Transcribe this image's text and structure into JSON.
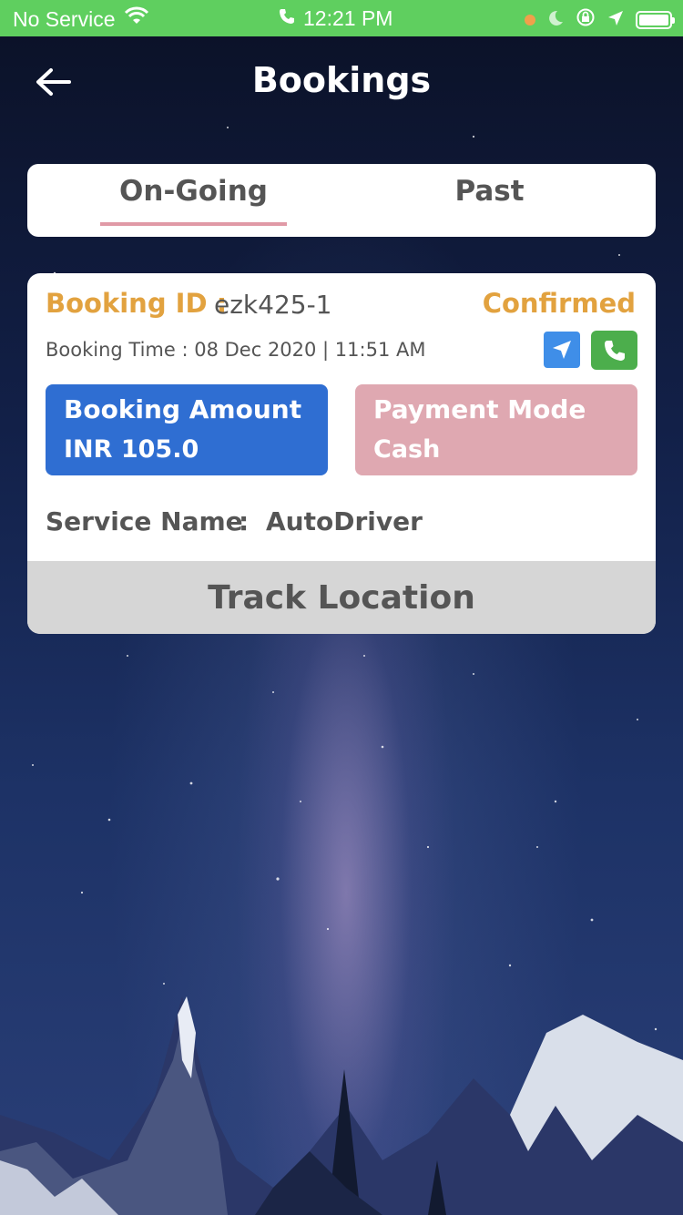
{
  "status_bar": {
    "carrier": "No Service",
    "time": "12:21 PM",
    "icons": [
      "wifi-icon",
      "phone-icon",
      "orange-dot-icon",
      "moon-icon",
      "rotation-lock-icon",
      "location-arrow-icon",
      "battery-icon"
    ],
    "color": "#5fcf5f"
  },
  "header": {
    "title": "Bookings",
    "back_icon": "back-arrow-icon"
  },
  "tabs": [
    {
      "label": "On-Going",
      "active": true
    },
    {
      "label": "Past",
      "active": false
    }
  ],
  "booking": {
    "id_label": "Booking ID :",
    "id_value": "ezk425-1",
    "status": "Confirmed",
    "time_text": "Booking Time : 08 Dec 2020 | 11:51 AM",
    "amount_title": "Booking Amount",
    "amount_value": "INR 105.0",
    "payment_title": "Payment Mode",
    "payment_value": "Cash",
    "service_label": "Service Name",
    "service_separator": ":",
    "service_value": "AutoDriver",
    "track_label": "Track Location",
    "actions": [
      "navigate-icon",
      "call-icon"
    ]
  },
  "colors": {
    "accent_orange": "#e2a23f",
    "amount_blue": "#2f6ed2",
    "payment_pink": "#dfa8b1",
    "tab_underline": "#e09aa6",
    "track_gray": "#d6d6d6"
  }
}
